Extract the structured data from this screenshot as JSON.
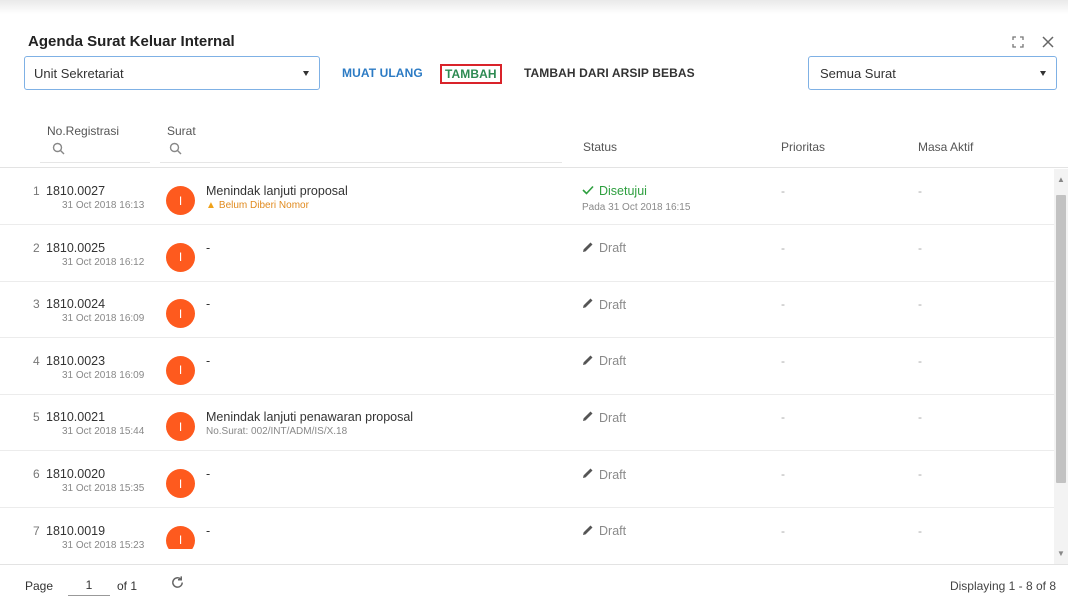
{
  "window": {
    "title": "Agenda Surat Keluar Internal",
    "maximize_icon": "maximize-icon",
    "close_icon": "close-icon"
  },
  "toolbar": {
    "unit_select": "Unit Sekretariat",
    "muat_ulang": "MUAT ULANG",
    "tambah": "TAMBAH",
    "tambah_arsip": "TAMBAH DARI ARSIP BEBAS",
    "filter_select": "Semua Surat"
  },
  "columns": {
    "no_registrasi": "No.Registrasi",
    "surat": "Surat",
    "status": "Status",
    "prioritas": "Prioritas",
    "masa_aktif": "Masa Aktif"
  },
  "rows": [
    {
      "num": "1",
      "reg": "1810.0027",
      "date": "31 Oct 2018 16:13",
      "avatar": "I",
      "title": "Menindak lanjuti proposal",
      "sub": "Belum Diberi Nomor",
      "sub_type": "warning",
      "status": "Disetujui",
      "status_type": "approved",
      "status_sub": "Pada 31 Oct 2018 16:15",
      "prioritas": "-",
      "masa_aktif": "-"
    },
    {
      "num": "2",
      "reg": "1810.0025",
      "date": "31 Oct 2018 16:12",
      "avatar": "I",
      "title": "-",
      "sub": "",
      "sub_type": "",
      "status": "Draft",
      "status_type": "draft",
      "status_sub": "",
      "prioritas": "-",
      "masa_aktif": "-"
    },
    {
      "num": "3",
      "reg": "1810.0024",
      "date": "31 Oct 2018 16:09",
      "avatar": "I",
      "title": "-",
      "sub": "",
      "sub_type": "",
      "status": "Draft",
      "status_type": "draft",
      "status_sub": "",
      "prioritas": "-",
      "masa_aktif": "-"
    },
    {
      "num": "4",
      "reg": "1810.0023",
      "date": "31 Oct 2018 16:09",
      "avatar": "I",
      "title": "-",
      "sub": "",
      "sub_type": "",
      "status": "Draft",
      "status_type": "draft",
      "status_sub": "",
      "prioritas": "-",
      "masa_aktif": "-"
    },
    {
      "num": "5",
      "reg": "1810.0021",
      "date": "31 Oct 2018 15:44",
      "avatar": "I",
      "title": "Menindak lanjuti penawaran proposal",
      "sub": "No.Surat: 002/INT/ADM/IS/X.18",
      "sub_type": "normal",
      "status": "Draft",
      "status_type": "draft",
      "status_sub": "",
      "prioritas": "-",
      "masa_aktif": "-"
    },
    {
      "num": "6",
      "reg": "1810.0020",
      "date": "31 Oct 2018 15:35",
      "avatar": "I",
      "title": "-",
      "sub": "",
      "sub_type": "",
      "status": "Draft",
      "status_type": "draft",
      "status_sub": "",
      "prioritas": "-",
      "masa_aktif": "-"
    },
    {
      "num": "7",
      "reg": "1810.0019",
      "date": "31 Oct 2018 15:23",
      "avatar": "I",
      "title": "-",
      "sub": "",
      "sub_type": "",
      "status": "Draft",
      "status_type": "draft",
      "status_sub": "",
      "prioritas": "-",
      "masa_aktif": "-"
    }
  ],
  "footer": {
    "page_label": "Page",
    "page_value": "1",
    "of_label": "of 1",
    "displaying": "Displaying 1 - 8 of 8"
  },
  "colors": {
    "avatar": "#fe5a1e",
    "approved": "#2e9f3f",
    "link_blue": "#2c7bc4",
    "tambah_border": "#d9232a",
    "warning": "#e08a1e"
  }
}
